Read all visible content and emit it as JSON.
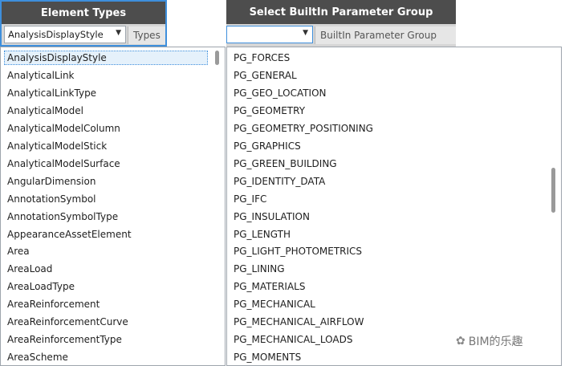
{
  "node1": {
    "title": "Element Types",
    "dropdown_value": "AnalysisDisplayStyle",
    "output_port": "Types",
    "selected_index": 0,
    "items": [
      "AnalysisDisplayStyle",
      "AnalyticalLink",
      "AnalyticalLinkType",
      "AnalyticalModel",
      "AnalyticalModelColumn",
      "AnalyticalModelStick",
      "AnalyticalModelSurface",
      "AngularDimension",
      "AnnotationSymbol",
      "AnnotationSymbolType",
      "AppearanceAssetElement",
      "Area",
      "AreaLoad",
      "AreaLoadType",
      "AreaReinforcement",
      "AreaReinforcementCurve",
      "AreaReinforcementType",
      "AreaScheme"
    ]
  },
  "node2": {
    "title": "Select BuiltIn Parameter Group",
    "dropdown_value": "",
    "output_port": "BuiltIn Parameter Group",
    "items": [
      "PG_FORCES",
      "PG_GENERAL",
      "PG_GEO_LOCATION",
      "PG_GEOMETRY",
      "PG_GEOMETRY_POSITIONING",
      "PG_GRAPHICS",
      "PG_GREEN_BUILDING",
      "PG_IDENTITY_DATA",
      "PG_IFC",
      "PG_INSULATION",
      "PG_LENGTH",
      "PG_LIGHT_PHOTOMETRICS",
      "PG_LINING",
      "PG_MATERIALS",
      "PG_MECHANICAL",
      "PG_MECHANICAL_AIRFLOW",
      "PG_MECHANICAL_LOADS",
      "PG_MOMENTS"
    ]
  },
  "icons": {
    "dropdown_arrow": "chevron-down-icon",
    "watermark": "wechat-icon"
  },
  "watermark": {
    "text": "BIM的乐趣"
  },
  "colors": {
    "header_bg": "#4d4d4d",
    "selection_border": "#3e8fdc",
    "list_bg": "#ffffff"
  }
}
